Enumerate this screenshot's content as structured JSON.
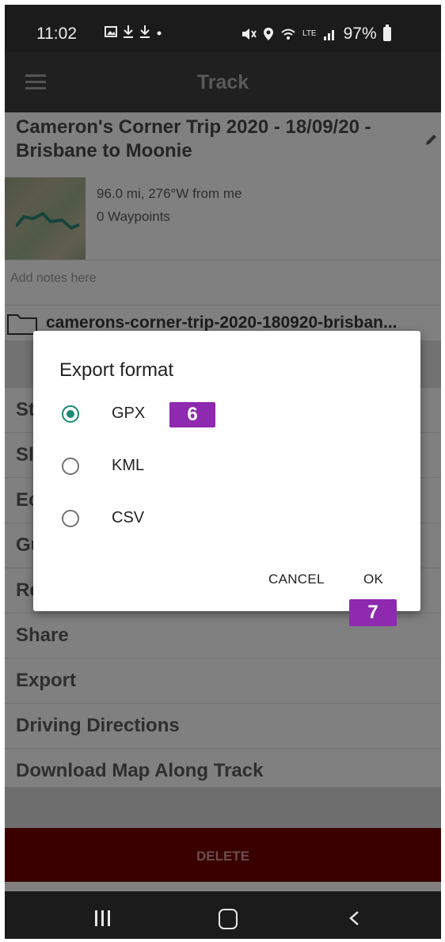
{
  "status_bar": {
    "time": "11:02",
    "battery_percent": "97%",
    "network_label": "LTE"
  },
  "app_bar": {
    "title": "Track"
  },
  "track": {
    "title": "Cameron's Corner Trip 2020 - 18/09/20 - Brisbane to Moonie",
    "distance_bearing": "96.0 mi, 276°W from me",
    "waypoints": "0 Waypoints",
    "notes_placeholder": "Add notes here",
    "folder_name": "camerons-corner-trip-2020-180920-brisban..."
  },
  "menu_items": [
    {
      "label": "St"
    },
    {
      "label": "Sl"
    },
    {
      "label": "Ec"
    },
    {
      "label": "Gu"
    },
    {
      "label": "Re"
    },
    {
      "label": "Share"
    },
    {
      "label": "Export"
    },
    {
      "label": "Driving Directions"
    },
    {
      "label": "Download Map Along Track"
    }
  ],
  "delete_label": "DELETE",
  "dialog": {
    "title": "Export format",
    "options": [
      {
        "label": "GPX",
        "selected": true
      },
      {
        "label": "KML",
        "selected": false
      },
      {
        "label": "CSV",
        "selected": false
      }
    ],
    "cancel_label": "CANCEL",
    "ok_label": "OK"
  },
  "annotations": {
    "badge_gpx": "6",
    "badge_ok": "7",
    "color": "#8e29b0"
  },
  "colors": {
    "accent_radio": "#1b8a74",
    "delete_bg": "#6b0000"
  }
}
